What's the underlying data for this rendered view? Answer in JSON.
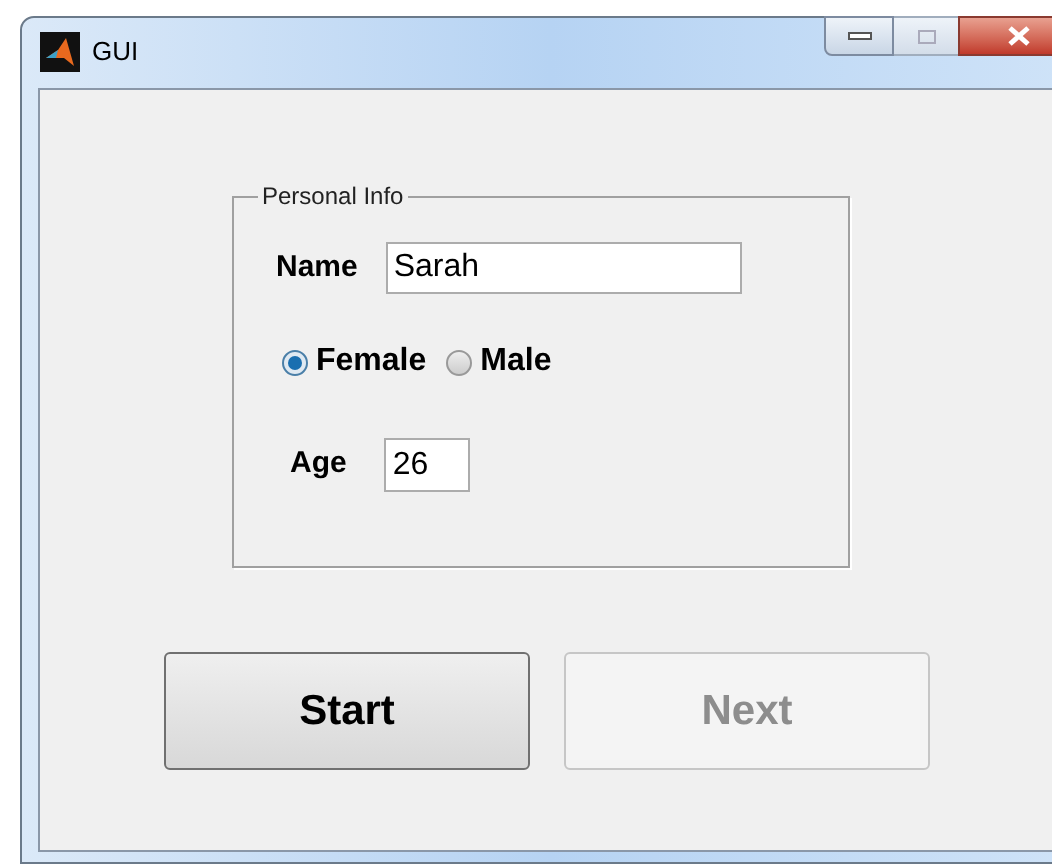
{
  "window": {
    "title": "GUI"
  },
  "panel": {
    "title": "Personal Info",
    "name": {
      "label": "Name",
      "value": "Sarah"
    },
    "gender": [
      {
        "label": "Female",
        "selected": true
      },
      {
        "label": "Male",
        "selected": false
      }
    ],
    "age": {
      "label": "Age",
      "value": "26"
    }
  },
  "buttons": [
    {
      "label": "Start",
      "disabled": false
    },
    {
      "label": "Next",
      "disabled": true
    }
  ]
}
